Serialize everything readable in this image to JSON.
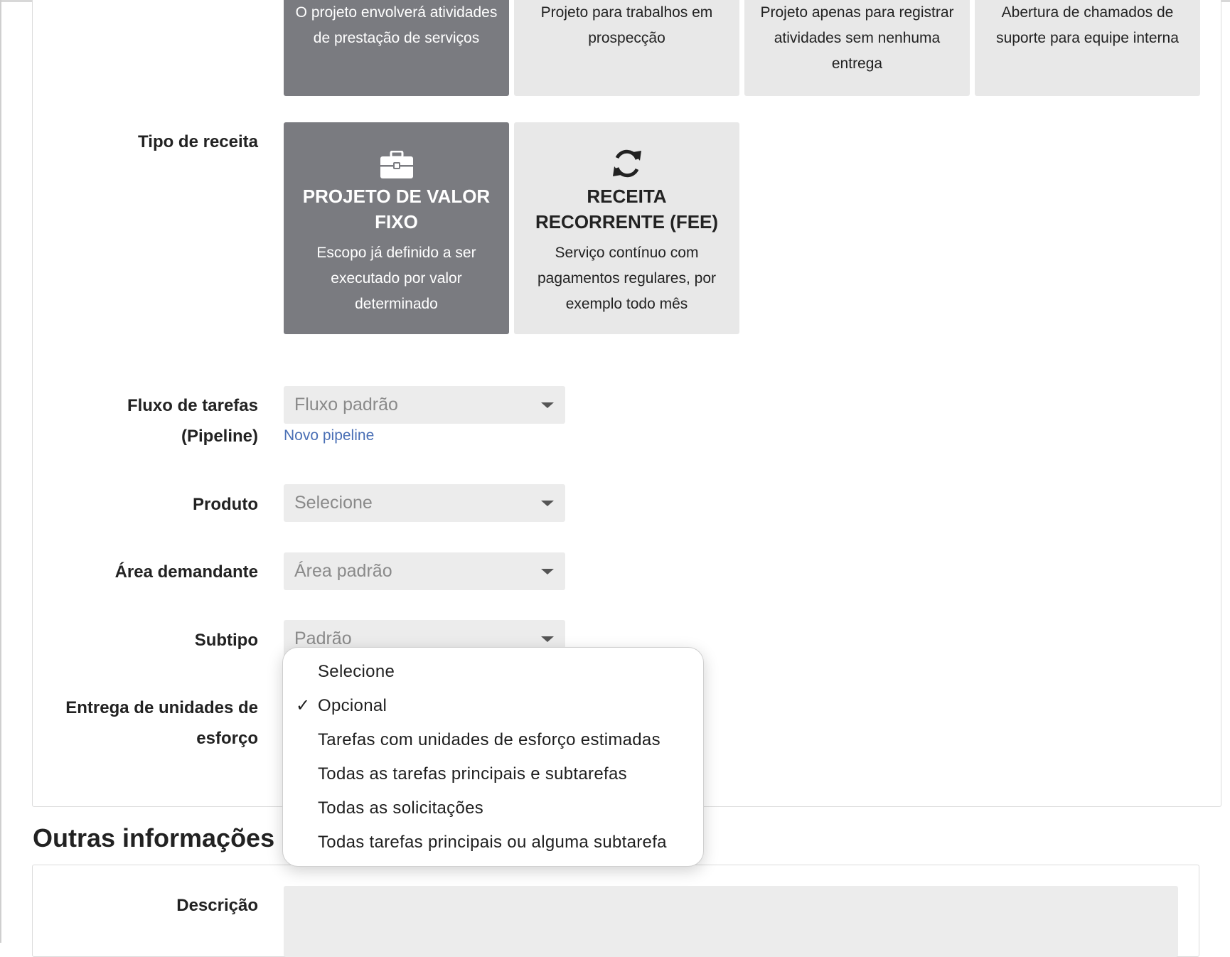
{
  "project_type_cards": [
    {
      "desc": "O projeto envolverá atividades de prestação de serviços",
      "selected": true
    },
    {
      "desc": "Projeto para trabalhos em prospecção",
      "selected": false
    },
    {
      "desc": "Projeto apenas para registrar atividades sem nenhuma entrega",
      "selected": false
    },
    {
      "desc": "Abertura de chamados de suporte para equipe interna",
      "selected": false
    }
  ],
  "revenue": {
    "label": "Tipo de receita",
    "fixed": {
      "icon": "briefcase-icon",
      "title": "PROJETO DE VALOR FIXO",
      "desc": "Escopo já definido a ser executado por valor determinado",
      "selected": true
    },
    "recurring": {
      "icon": "refresh-icon",
      "title": "RECEITA RECORRENTE (FEE)",
      "desc": "Serviço contínuo com pagamentos regulares, por exemplo todo mês",
      "selected": false
    }
  },
  "fields": {
    "pipeline_label": "Fluxo de tarefas (Pipeline)",
    "pipeline_value": "Fluxo padrão",
    "pipeline_link": "Novo pipeline",
    "product_label": "Produto",
    "product_value": "Selecione",
    "area_label": "Área demandante",
    "area_value": "Área padrão",
    "subtype_label": "Subtipo",
    "subtype_value": "Padrão",
    "effort_label": "Entrega de unidades de esforço"
  },
  "effort_dropdown": {
    "options": [
      "Selecione",
      "Opcional",
      "Tarefas com unidades de esforço estimadas",
      "Todas as tarefas principais e subtarefas",
      "Todas as solicitações",
      "Todas tarefas principais ou alguma subtarefa"
    ],
    "selected": "Opcional",
    "checkmark": "✓"
  },
  "other_info": {
    "title": "Outras informações",
    "description_label": "Descrição"
  },
  "colors": {
    "selected_card": "#7a7b80",
    "unselected_card": "#e8e8e8",
    "link": "#4a6fb5",
    "input_bg": "#ececec"
  }
}
